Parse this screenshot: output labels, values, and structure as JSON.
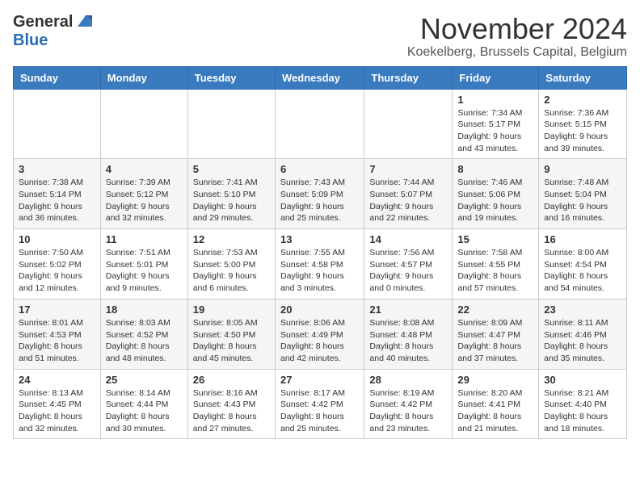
{
  "logo": {
    "general": "General",
    "blue": "Blue"
  },
  "title": "November 2024",
  "location": "Koekelberg, Brussels Capital, Belgium",
  "headers": [
    "Sunday",
    "Monday",
    "Tuesday",
    "Wednesday",
    "Thursday",
    "Friday",
    "Saturday"
  ],
  "weeks": [
    [
      {
        "day": "",
        "info": ""
      },
      {
        "day": "",
        "info": ""
      },
      {
        "day": "",
        "info": ""
      },
      {
        "day": "",
        "info": ""
      },
      {
        "day": "",
        "info": ""
      },
      {
        "day": "1",
        "info": "Sunrise: 7:34 AM\nSunset: 5:17 PM\nDaylight: 9 hours\nand 43 minutes."
      },
      {
        "day": "2",
        "info": "Sunrise: 7:36 AM\nSunset: 5:15 PM\nDaylight: 9 hours\nand 39 minutes."
      }
    ],
    [
      {
        "day": "3",
        "info": "Sunrise: 7:38 AM\nSunset: 5:14 PM\nDaylight: 9 hours\nand 36 minutes."
      },
      {
        "day": "4",
        "info": "Sunrise: 7:39 AM\nSunset: 5:12 PM\nDaylight: 9 hours\nand 32 minutes."
      },
      {
        "day": "5",
        "info": "Sunrise: 7:41 AM\nSunset: 5:10 PM\nDaylight: 9 hours\nand 29 minutes."
      },
      {
        "day": "6",
        "info": "Sunrise: 7:43 AM\nSunset: 5:09 PM\nDaylight: 9 hours\nand 25 minutes."
      },
      {
        "day": "7",
        "info": "Sunrise: 7:44 AM\nSunset: 5:07 PM\nDaylight: 9 hours\nand 22 minutes."
      },
      {
        "day": "8",
        "info": "Sunrise: 7:46 AM\nSunset: 5:06 PM\nDaylight: 9 hours\nand 19 minutes."
      },
      {
        "day": "9",
        "info": "Sunrise: 7:48 AM\nSunset: 5:04 PM\nDaylight: 9 hours\nand 16 minutes."
      }
    ],
    [
      {
        "day": "10",
        "info": "Sunrise: 7:50 AM\nSunset: 5:02 PM\nDaylight: 9 hours\nand 12 minutes."
      },
      {
        "day": "11",
        "info": "Sunrise: 7:51 AM\nSunset: 5:01 PM\nDaylight: 9 hours\nand 9 minutes."
      },
      {
        "day": "12",
        "info": "Sunrise: 7:53 AM\nSunset: 5:00 PM\nDaylight: 9 hours\nand 6 minutes."
      },
      {
        "day": "13",
        "info": "Sunrise: 7:55 AM\nSunset: 4:58 PM\nDaylight: 9 hours\nand 3 minutes."
      },
      {
        "day": "14",
        "info": "Sunrise: 7:56 AM\nSunset: 4:57 PM\nDaylight: 9 hours\nand 0 minutes."
      },
      {
        "day": "15",
        "info": "Sunrise: 7:58 AM\nSunset: 4:55 PM\nDaylight: 8 hours\nand 57 minutes."
      },
      {
        "day": "16",
        "info": "Sunrise: 8:00 AM\nSunset: 4:54 PM\nDaylight: 8 hours\nand 54 minutes."
      }
    ],
    [
      {
        "day": "17",
        "info": "Sunrise: 8:01 AM\nSunset: 4:53 PM\nDaylight: 8 hours\nand 51 minutes."
      },
      {
        "day": "18",
        "info": "Sunrise: 8:03 AM\nSunset: 4:52 PM\nDaylight: 8 hours\nand 48 minutes."
      },
      {
        "day": "19",
        "info": "Sunrise: 8:05 AM\nSunset: 4:50 PM\nDaylight: 8 hours\nand 45 minutes."
      },
      {
        "day": "20",
        "info": "Sunrise: 8:06 AM\nSunset: 4:49 PM\nDaylight: 8 hours\nand 42 minutes."
      },
      {
        "day": "21",
        "info": "Sunrise: 8:08 AM\nSunset: 4:48 PM\nDaylight: 8 hours\nand 40 minutes."
      },
      {
        "day": "22",
        "info": "Sunrise: 8:09 AM\nSunset: 4:47 PM\nDaylight: 8 hours\nand 37 minutes."
      },
      {
        "day": "23",
        "info": "Sunrise: 8:11 AM\nSunset: 4:46 PM\nDaylight: 8 hours\nand 35 minutes."
      }
    ],
    [
      {
        "day": "24",
        "info": "Sunrise: 8:13 AM\nSunset: 4:45 PM\nDaylight: 8 hours\nand 32 minutes."
      },
      {
        "day": "25",
        "info": "Sunrise: 8:14 AM\nSunset: 4:44 PM\nDaylight: 8 hours\nand 30 minutes."
      },
      {
        "day": "26",
        "info": "Sunrise: 8:16 AM\nSunset: 4:43 PM\nDaylight: 8 hours\nand 27 minutes."
      },
      {
        "day": "27",
        "info": "Sunrise: 8:17 AM\nSunset: 4:42 PM\nDaylight: 8 hours\nand 25 minutes."
      },
      {
        "day": "28",
        "info": "Sunrise: 8:19 AM\nSunset: 4:42 PM\nDaylight: 8 hours\nand 23 minutes."
      },
      {
        "day": "29",
        "info": "Sunrise: 8:20 AM\nSunset: 4:41 PM\nDaylight: 8 hours\nand 21 minutes."
      },
      {
        "day": "30",
        "info": "Sunrise: 8:21 AM\nSunset: 4:40 PM\nDaylight: 8 hours\nand 18 minutes."
      }
    ]
  ]
}
